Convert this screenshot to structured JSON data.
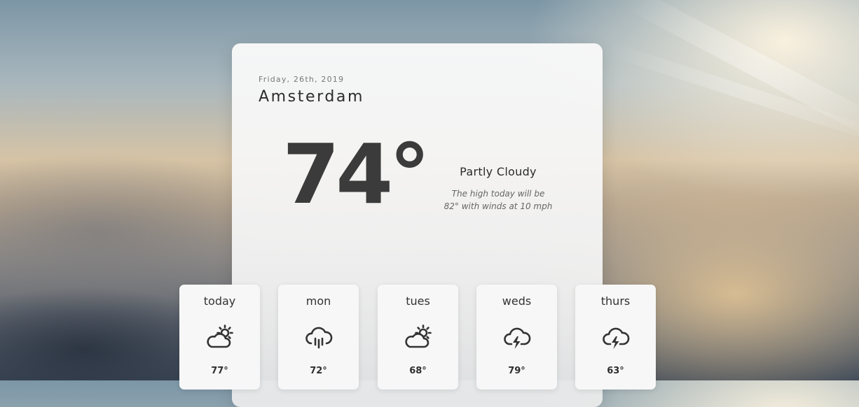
{
  "weather": {
    "date": "Friday, 26th, 2019",
    "city": "Amsterdam",
    "temperature": "74°",
    "condition": "Partly Cloudy",
    "description_line1": "The high today will be",
    "description_line2": "82° with winds at 10 mph"
  },
  "forecast": [
    {
      "day": "today",
      "icon": "partly-cloudy-icon",
      "high": "77°"
    },
    {
      "day": "mon",
      "icon": "rain-cloud-icon",
      "high": "72°"
    },
    {
      "day": "tues",
      "icon": "partly-cloudy-icon",
      "high": "68°"
    },
    {
      "day": "weds",
      "icon": "thunderstorm-icon",
      "high": "79°"
    },
    {
      "day": "thurs",
      "icon": "thunderstorm-icon",
      "high": "63°"
    }
  ]
}
